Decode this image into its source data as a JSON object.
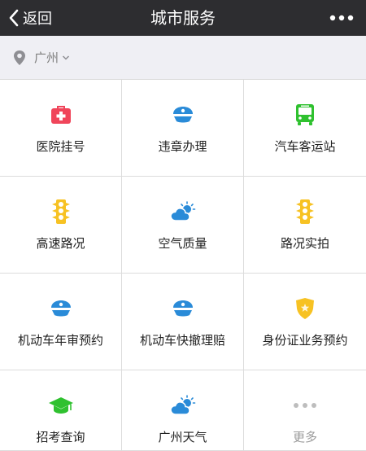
{
  "nav": {
    "back_label": "返回",
    "title": "城市服务"
  },
  "location": {
    "city": "广州"
  },
  "colors": {
    "nav_bg": "#2d2d30",
    "red": "#f0455a",
    "blue": "#2a8bd8",
    "green": "#2fc12f",
    "yellow": "#f7c223",
    "muted": "#9a9a9a"
  },
  "services": [
    {
      "label": "医院挂号",
      "icon": "medical-kit-icon"
    },
    {
      "label": "违章办理",
      "icon": "police-cap-icon"
    },
    {
      "label": "汽车客运站",
      "icon": "bus-icon"
    },
    {
      "label": "高速路况",
      "icon": "traffic-light-icon"
    },
    {
      "label": "空气质量",
      "icon": "cloud-sun-icon"
    },
    {
      "label": "路况实拍",
      "icon": "traffic-light-icon"
    },
    {
      "label": "机动车年审预约",
      "icon": "police-cap-icon"
    },
    {
      "label": "机动车快撤理赔",
      "icon": "police-cap-icon"
    },
    {
      "label": "身份证业务预约",
      "icon": "police-badge-icon"
    },
    {
      "label": "招考查询",
      "icon": "graduation-cap-icon"
    },
    {
      "label": "广州天气",
      "icon": "cloud-sun-icon"
    },
    {
      "label": "更多",
      "icon": "more-dots-icon"
    }
  ]
}
